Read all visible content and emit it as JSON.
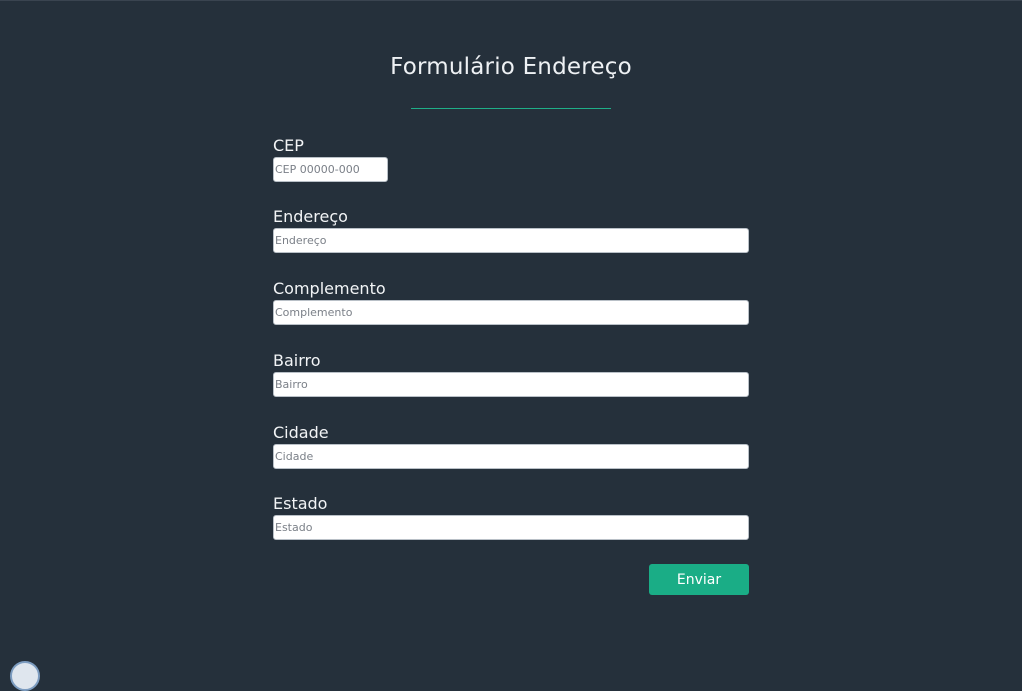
{
  "page": {
    "title": "Formulário Endereço"
  },
  "form": {
    "fields": [
      {
        "label": "CEP",
        "placeholder": "CEP 00000-000",
        "value": ""
      },
      {
        "label": "Endereço",
        "placeholder": "Endereço",
        "value": ""
      },
      {
        "label": "Complemento",
        "placeholder": "Complemento",
        "value": ""
      },
      {
        "label": "Bairro",
        "placeholder": "Bairro",
        "value": ""
      },
      {
        "label": "Cidade",
        "placeholder": "Cidade",
        "value": ""
      },
      {
        "label": "Estado",
        "placeholder": "Estado",
        "value": ""
      }
    ],
    "submit_label": "Enviar"
  },
  "colors": {
    "background": "#25303b",
    "accent": "#1aad86",
    "text": "#f2f4f6"
  }
}
